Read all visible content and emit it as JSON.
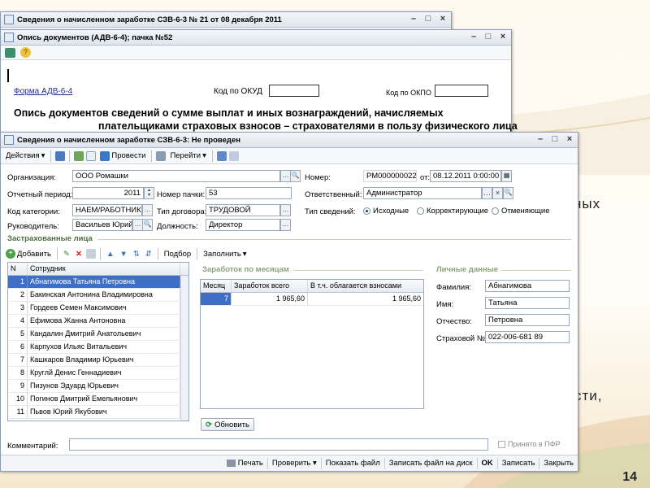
{
  "slide": {
    "bg_text_1": "ных",
    "bg_text_2": "сти,",
    "page_number": "14"
  },
  "win_back": {
    "title": "Сведения о начисленном заработке СЗВ-6-3 № 21 от 08 декабря 2011"
  },
  "win_mid": {
    "title": "Опись документов (АДВ-6-4); пачка №52",
    "form_name": "Форма АДВ-6-4",
    "okud_label": "Код по ОКУД",
    "okpo_label": "Код по ОКПО",
    "heading_line1": "Опись документов сведений о сумме выплат и иных вознаграждений, начисляемых",
    "heading_line2": "плательщиками страховых взносов – страхователями в пользу физического лица"
  },
  "win": {
    "title": "Сведения о начисленном заработке СЗВ-6-3: Не проведен",
    "toolbar": {
      "actions": "Действия",
      "post": "Провести",
      "goto": "Перейти"
    },
    "form": {
      "org_label": "Организация:",
      "org_value": "ООО Ромашки",
      "period_label": "Отчетный период:",
      "period_value": "2011",
      "pack_label": "Номер пачки:",
      "pack_value": "53",
      "category_label": "Код категории:",
      "category_value": "НАЕМ/РАБОТНИК",
      "contract_label": "Тип договора:",
      "contract_value": "ТРУДОВОЙ",
      "head_label": "Руководитель:",
      "head_value": "Васильев Юрий I",
      "position_label": "Должность:",
      "position_value": "Директор",
      "number_label": "Номер:",
      "number_value": "РМ000000022",
      "date_label": "от:",
      "date_value": "08.12.2011 0:00:00",
      "resp_label": "Ответственный:",
      "resp_value": "Администратор",
      "info_type_label": "Тип сведений:",
      "info_types": [
        "Исходные",
        "Корректирующие",
        "Отменяющие"
      ]
    },
    "insured_section": "Застрахованные лица",
    "insured_toolbar": {
      "add": "Добавить",
      "pick": "Подбор",
      "fill": "Заполнить"
    },
    "employees_grid": {
      "columns": [
        "N",
        "Сотрудник"
      ],
      "rows": [
        [
          "1",
          "Абнагимова Татьяна Петровна"
        ],
        [
          "2",
          "Бакинская Антонина Владимировна"
        ],
        [
          "3",
          "Гордеев Семен Максимович"
        ],
        [
          "4",
          "Ефимова Жанна Антоновна"
        ],
        [
          "5",
          "Кандалин Дмитрий Анатольевич"
        ],
        [
          "6",
          "Карпухов Ильяс Витальевич"
        ],
        [
          "7",
          "Кашкаров Владимир Юрьевич"
        ],
        [
          "8",
          "Круглй Денис Геннадиевич"
        ],
        [
          "9",
          "Пизунов Эдуард Юрьевич"
        ],
        [
          "10",
          "Погинов Дмитрий Емельянович"
        ],
        [
          "11",
          "Пьвов Юрий Якубович"
        ]
      ]
    },
    "earnings_section": "Заработок по месяцам",
    "earnings_grid": {
      "columns": [
        "Месяц",
        "Заработок всего",
        "В т.ч. облагается взносами"
      ],
      "rows": [
        [
          "7",
          "1 965,60",
          "1 965,60"
        ]
      ]
    },
    "refresh_button": "Обновить",
    "personal_section": "Личные данные",
    "personal": {
      "surname_label": "Фамилия:",
      "surname": "Абнагимова",
      "name_label": "Имя:",
      "name": "Татьяна",
      "patronymic_label": "Отчество:",
      "patronymic": "Петровна",
      "snils_label": "Страховой №:",
      "snils": "022-006-681 89"
    },
    "comment_label": "Комментарий:",
    "accepted_label": "Принято в ПФР",
    "bottom": {
      "print": "Печать",
      "check": "Проверить",
      "show_file": "Показать файл",
      "save_file": "Записать файл на диск",
      "ok": "OK",
      "save": "Записать",
      "close": "Закрыть"
    }
  }
}
